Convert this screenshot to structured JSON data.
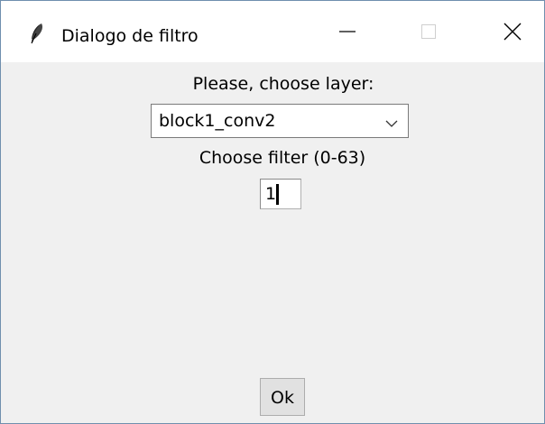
{
  "window": {
    "title": "Dialogo de filtro"
  },
  "titlebar": {
    "app_icon": "feather-icon",
    "minimize_icon": "minimize-icon",
    "maximize_icon": "maximize-icon",
    "close_icon": "close-icon"
  },
  "form": {
    "layer_label": "Please, choose layer:",
    "layer_selected": "block1_conv2",
    "layer_dropdown_icon": "chevron-down-icon",
    "filter_label": "Choose filter (0-63)",
    "filter_value": "1",
    "ok_label": "Ok"
  },
  "colors": {
    "titlebar_bg": "#ffffff",
    "window_bg": "#f0f0f0",
    "button_bg": "#e1e1e1",
    "window_border": "#6f8fae"
  }
}
